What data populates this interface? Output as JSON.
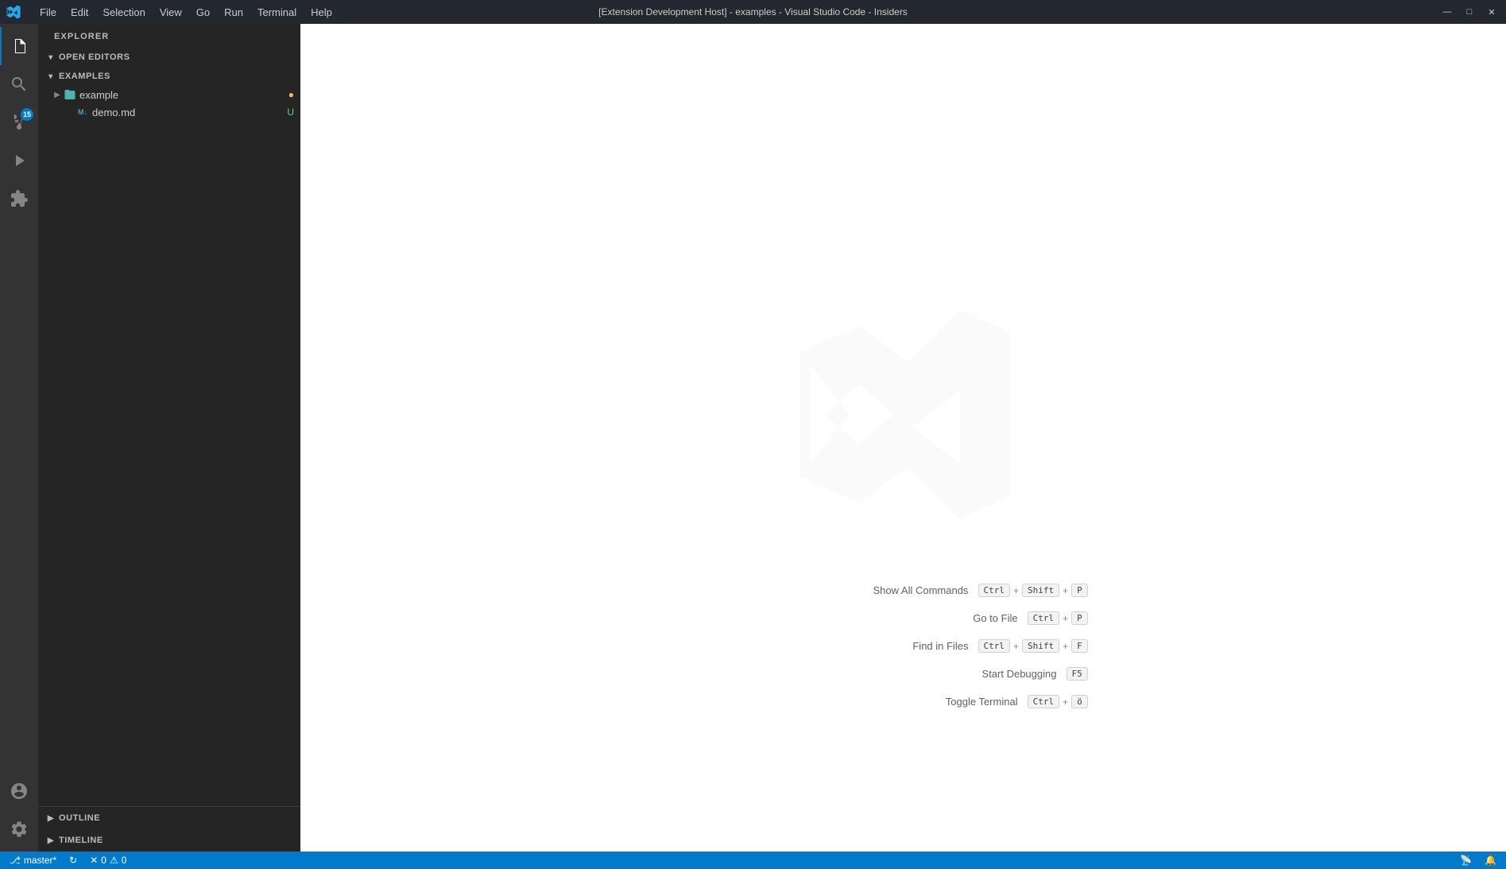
{
  "titlebar": {
    "title": "[Extension Development Host] - examples - Visual Studio Code - Insiders",
    "menu": {
      "file": "File",
      "edit": "Edit",
      "selection": "Selection",
      "view": "View",
      "go": "Go",
      "run": "Run",
      "terminal": "Terminal",
      "help": "Help"
    },
    "window_controls": {
      "minimize": "—",
      "maximize": "□",
      "close": "✕"
    }
  },
  "sidebar": {
    "header": "EXPLORER",
    "sections": {
      "open_editors": "OPEN EDITORS",
      "examples": "EXAMPLES"
    },
    "tree": {
      "example_folder": "example",
      "demo_file": "demo.md",
      "demo_status": "U"
    },
    "bottom": {
      "outline": "OUTLINE",
      "timeline": "TIMELINE"
    }
  },
  "activity_bar": {
    "items": [
      {
        "name": "explorer",
        "label": "Explorer"
      },
      {
        "name": "search",
        "label": "Search"
      },
      {
        "name": "source-control",
        "label": "Source Control",
        "badge": "15"
      },
      {
        "name": "run-debug",
        "label": "Run and Debug"
      },
      {
        "name": "extensions",
        "label": "Extensions"
      }
    ],
    "bottom": [
      {
        "name": "account",
        "label": "Account"
      },
      {
        "name": "settings",
        "label": "Settings"
      }
    ]
  },
  "editor": {
    "shortcuts": [
      {
        "label": "Show All Commands",
        "keys": [
          "Ctrl",
          "+",
          "Shift",
          "+",
          "P"
        ]
      },
      {
        "label": "Go to File",
        "keys": [
          "Ctrl",
          "+",
          "P"
        ]
      },
      {
        "label": "Find in Files",
        "keys": [
          "Ctrl",
          "+",
          "Shift",
          "+",
          "F"
        ]
      },
      {
        "label": "Start Debugging",
        "keys": [
          "F5"
        ]
      },
      {
        "label": "Toggle Terminal",
        "keys": [
          "Ctrl",
          "+",
          "ö"
        ]
      }
    ]
  },
  "status_bar": {
    "branch": "master*",
    "sync": "↻",
    "errors": "0",
    "warnings": "0",
    "bell_label": "🔔",
    "broadcast_label": "📡"
  }
}
